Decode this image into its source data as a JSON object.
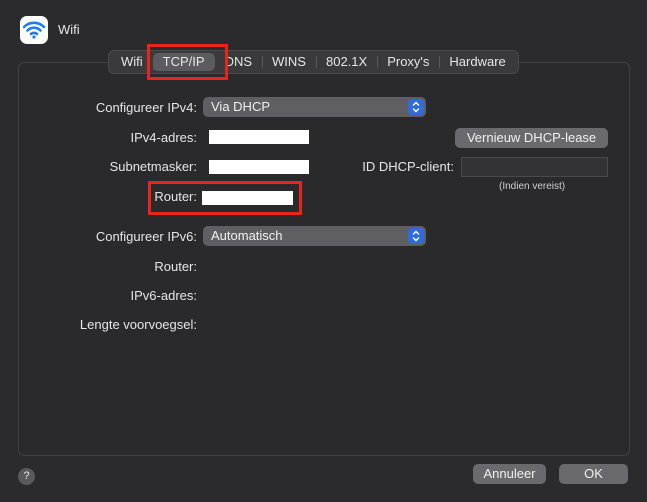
{
  "window": {
    "title": "Wifi",
    "icon": "wifi-icon"
  },
  "tabs": [
    "Wifi",
    "TCP/IP",
    "DNS",
    "WINS",
    "802.1X",
    "Proxy's",
    "Hardware"
  ],
  "active_tab": "TCP/IP",
  "ipv4": {
    "configure_label": "Configureer IPv4:",
    "configure_value": "Via DHCP",
    "address_label": "IPv4-adres:",
    "subnet_label": "Subnetmasker:",
    "router_label": "Router:",
    "renew_button": "Vernieuw DHCP-lease",
    "dhcp_client_label": "ID DHCP-client:",
    "dhcp_client_value": "",
    "dhcp_client_hint": "(Indien vereist)"
  },
  "ipv6": {
    "configure_label": "Configureer IPv6:",
    "configure_value": "Automatisch",
    "router_label": "Router:",
    "address_label": "IPv6-adres:",
    "prefix_label": "Lengte voorvoegsel:"
  },
  "footer": {
    "help_label": "?",
    "cancel": "Annuleer",
    "ok": "OK"
  },
  "colors": {
    "highlight": "#e8251a",
    "accent": "#2f6bdc",
    "background": "#2b2b2d"
  }
}
